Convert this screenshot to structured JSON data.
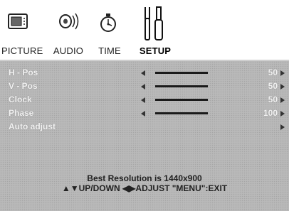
{
  "tabs": [
    {
      "label": "PICTURE",
      "icon": "picture-icon"
    },
    {
      "label": "AUDIO",
      "icon": "audio-icon"
    },
    {
      "label": "TIME",
      "icon": "clock-icon"
    },
    {
      "label": "SETUP",
      "icon": "tools-icon",
      "active": true
    }
  ],
  "setup": {
    "items": [
      {
        "label": "H - Pos",
        "value": "50"
      },
      {
        "label": "V - Pos",
        "value": "50"
      },
      {
        "label": "Clock",
        "value": "50"
      },
      {
        "label": "Phase",
        "value": "100"
      },
      {
        "label": "Auto adjust"
      }
    ]
  },
  "footer": {
    "resolution": "Best Resolution is 1440x900",
    "hint": "▲▼UP/DOWN ◀▶ADJUST \"MENU\":EXIT"
  },
  "colors": {
    "panel": "#b9b9b9",
    "text": "#f2f2f2"
  }
}
